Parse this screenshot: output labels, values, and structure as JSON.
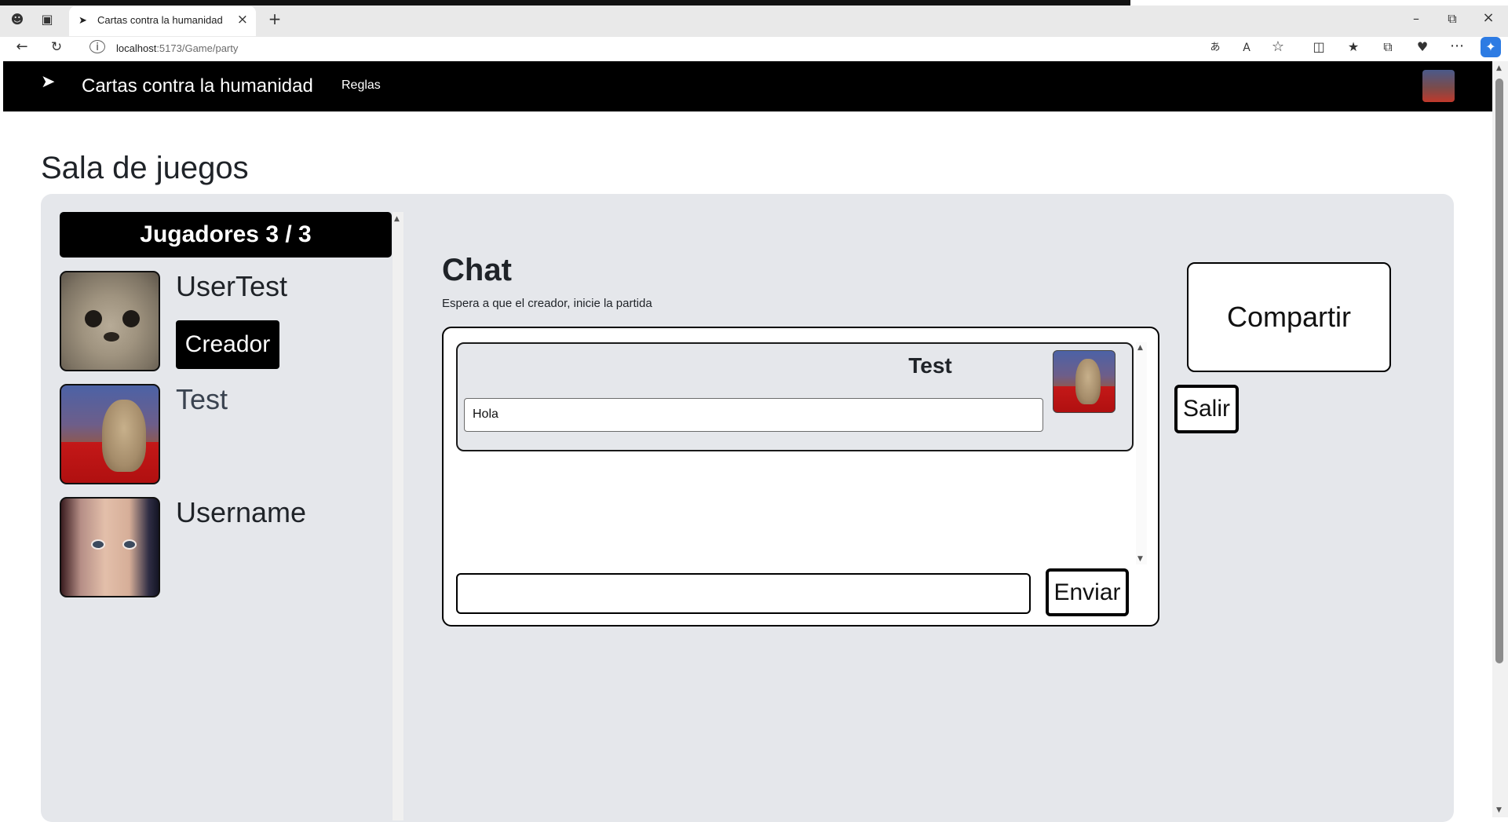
{
  "browser": {
    "tab_title": "Cartas contra la humanidad",
    "url_host": "localhost",
    "url_path": ":5173/Game/party"
  },
  "navbar": {
    "brand": "Cartas contra la humanidad",
    "rules_link": "Reglas"
  },
  "page": {
    "title": "Sala de juegos"
  },
  "players": {
    "header": "Jugadores 3 / 3",
    "list": [
      {
        "name": "UserTest",
        "badge": "Creador"
      },
      {
        "name": "Test"
      },
      {
        "name": "Username"
      }
    ]
  },
  "chat": {
    "title": "Chat",
    "subtitle": "Espera a que el creador, inicie la partida",
    "messages": [
      {
        "author": "Test",
        "text": "Hola"
      }
    ],
    "input_value": "",
    "send_label": "Enviar"
  },
  "actions": {
    "share_label": "Compartir",
    "exit_label": "Salir"
  },
  "colors": {
    "navbar_bg": "#000000",
    "panel_bg": "#e5e7eb"
  }
}
